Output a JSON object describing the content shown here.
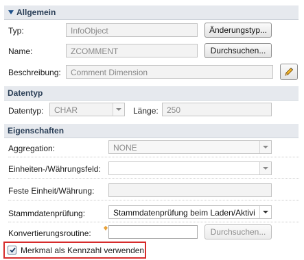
{
  "sections": {
    "general": "Allgemein",
    "datatype": "Datentyp",
    "properties": "Eigenschaften"
  },
  "general": {
    "type_label": "Typ:",
    "type_value": "InfoObject",
    "change_type_button": "Änderungstyp...",
    "name_label": "Name:",
    "name_value": "ZCOMMENT",
    "browse_button": "Durchsuchen...",
    "description_label": "Beschreibung:",
    "description_value": "Comment Dimension",
    "edit_icon": "pencil-icon"
  },
  "datatype": {
    "datatype_label": "Datentyp:",
    "datatype_value": "CHAR",
    "length_label": "Länge:",
    "length_value": "250"
  },
  "properties": {
    "aggregation_label": "Aggregation:",
    "aggregation_value": "NONE",
    "unit_field_label": "Einheiten-/Währungsfeld:",
    "unit_field_value": "",
    "fixed_unit_label": "Feste Einheit/Währung:",
    "fixed_unit_value": "",
    "master_check_label": "Stammdatenprüfung:",
    "master_check_value": "Stammdatenprüfung beim Laden/Aktivi",
    "conversion_label": "Konvertierungsroutine:",
    "conversion_value": "",
    "conversion_browse_button": "Durchsuchen...",
    "keyfigure_checkbox_label": "Merkmal als Kennzahl verwenden",
    "keyfigure_checked": true
  },
  "colors": {
    "highlight": "#d62b2b",
    "section_bg": "#e6e9ee",
    "section_text": "#2b3f57"
  }
}
